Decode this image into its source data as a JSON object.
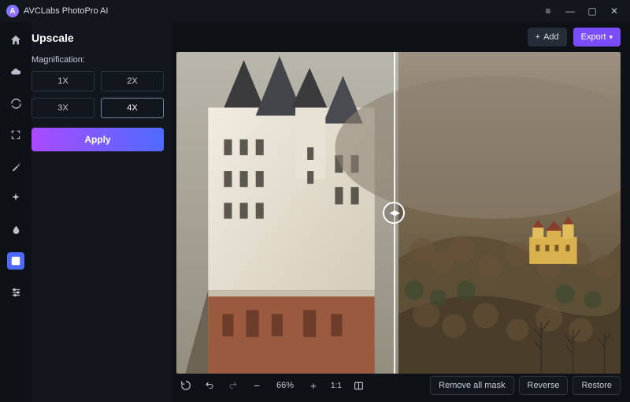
{
  "window": {
    "title": "AVCLabs PhotoPro AI",
    "logo_initial": "A"
  },
  "panel": {
    "title": "Upscale",
    "magnification_label": "Magnification:",
    "mag_options": [
      "1X",
      "2X",
      "3X",
      "4X"
    ],
    "mag_selected": "4X",
    "apply_label": "Apply"
  },
  "rail": {
    "items": [
      "home",
      "cloud",
      "refresh",
      "expand",
      "wand",
      "sparkle",
      "drop",
      "layers",
      "sliders"
    ],
    "active_index": 7
  },
  "topbar": {
    "add_label": "Add",
    "export_label": "Export"
  },
  "viewer": {
    "compare_split_percent": 49
  },
  "bottombar": {
    "zoom_percent": "66%",
    "one_to_one": "1:1",
    "remove_mask_label": "Remove all mask",
    "reverse_label": "Reverse",
    "restore_label": "Restore"
  },
  "colors": {
    "accent_purple": "#7a4dff",
    "accent_blue": "#4f6bff",
    "bg": "#0e1217"
  }
}
